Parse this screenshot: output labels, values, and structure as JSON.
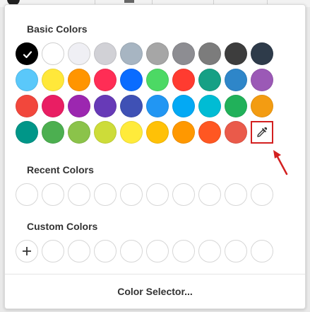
{
  "picker": {
    "basic_title": "Basic Colors",
    "recent_title": "Recent Colors",
    "custom_title": "Custom Colors",
    "selector_label": "Color Selector...",
    "selected_color": "#000000",
    "basic_rows": [
      [
        "#000000",
        "#ffffff",
        "#efeff4",
        "#d1d1d6",
        "#a7b5c2",
        "#a6a6a6",
        "#8d8d92",
        "#7c7c7c",
        "#3d3d3d",
        "#2e3b4a"
      ],
      [
        "#5ac8fa",
        "#ffe83a",
        "#ff9500",
        "#ff2d55",
        "#0a6cff",
        "#4cd964",
        "#ff3b30",
        "#16a085",
        "#2e86c9",
        "#9b59b6"
      ],
      [
        "#f2473c",
        "#e91e63",
        "#9c27b0",
        "#673ab7",
        "#3f51b5",
        "#2196f3",
        "#03a9f4",
        "#00bcd4",
        "#21b15a",
        "#f39c12"
      ],
      [
        "#009688",
        "#4caf50",
        "#8bc34a",
        "#cddc39",
        "#ffeb3b",
        "#ffc107",
        "#ff9800",
        "#ff5722",
        "#ea5a4a"
      ]
    ],
    "recent_slots": 10,
    "custom_slots": 9,
    "icons": {
      "check": "check-icon",
      "eyedropper": "eyedropper-icon",
      "plus": "plus-icon",
      "arrow": "arrow-annotation"
    },
    "highlight_color": "#d32020"
  }
}
